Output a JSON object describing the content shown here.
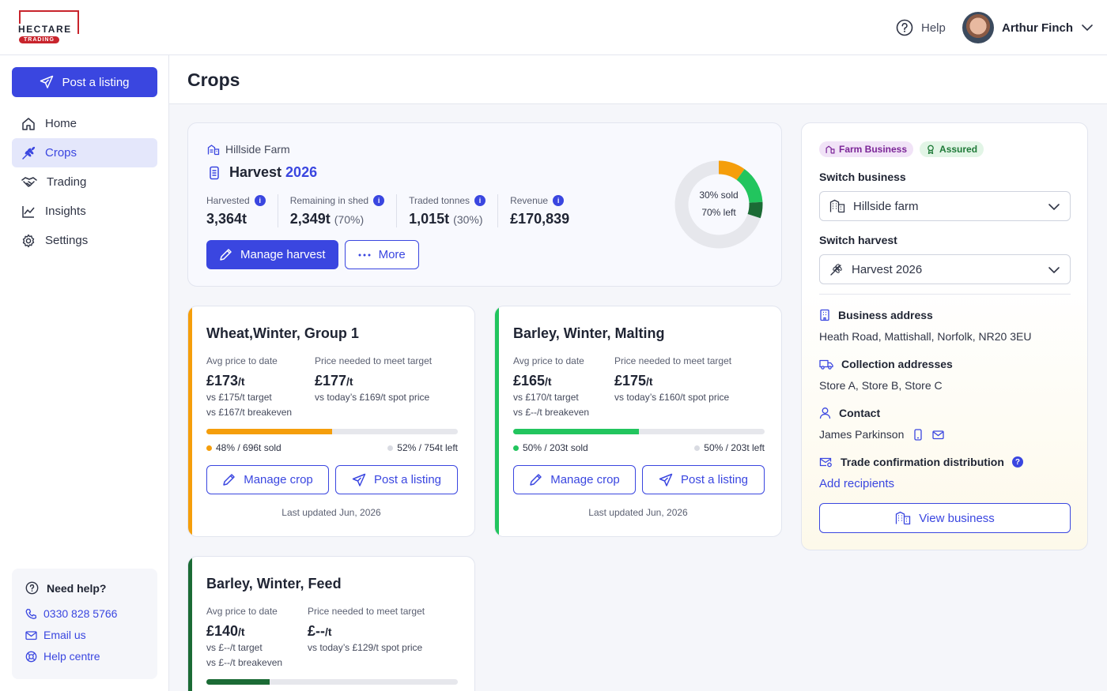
{
  "brand": {
    "name": "HECTARE",
    "sub": "TRADING",
    "accent": "#c8242c",
    "primary": "#3a46e0"
  },
  "topbar": {
    "help_label": "Help",
    "user_name": "Arthur Finch"
  },
  "sidebar": {
    "post_label": "Post a listing",
    "items": [
      {
        "label": "Home",
        "icon": "home-icon"
      },
      {
        "label": "Crops",
        "icon": "wheat-icon",
        "active": true
      },
      {
        "label": "Trading",
        "icon": "handshake-icon"
      },
      {
        "label": "Insights",
        "icon": "chart-line-icon"
      },
      {
        "label": "Settings",
        "icon": "gear-icon"
      }
    ],
    "help": {
      "title": "Need help?",
      "phone": "0330 828 5766",
      "email": "Email us",
      "centre": "Help centre"
    }
  },
  "page": {
    "title": "Crops"
  },
  "harvest": {
    "farm": "Hillside Farm",
    "title": "Harvest",
    "year": "2026",
    "stats": [
      {
        "label": "Harvested",
        "value": "3,364t",
        "pct": ""
      },
      {
        "label": "Remaining in shed",
        "value": "2,349t",
        "pct": "(70%)"
      },
      {
        "label": "Traded tonnes",
        "value": "1,015t",
        "pct": "(30%)"
      },
      {
        "label": "Revenue",
        "value": "£170,839",
        "pct": ""
      }
    ],
    "manage_label": "Manage harvest",
    "more_label": "More",
    "donut": {
      "sold_text": "30% sold",
      "left_text": "70% left",
      "segments": [
        0.1,
        0.14,
        0.06
      ],
      "colors": [
        "#f59e0b",
        "#22c55e",
        "#1b6b35"
      ],
      "track": "#e6e7ec"
    }
  },
  "crops": [
    {
      "name": "Wheat,Winter, Group 1",
      "color": "#f59e0b",
      "avg_label": "Avg price to date",
      "avg_price": "£173",
      "avg_unit": "/t",
      "avg_sub1": "vs £175/t target",
      "avg_sub2": "vs £167/t breakeven",
      "need_label": "Price needed to meet target",
      "need_price": "£177",
      "need_unit": "/t",
      "need_sub": "vs today’s £169/t spot price",
      "sold_fraction": 0.5,
      "sold_text": "48% / 696t sold",
      "left_text": "52% / 754t left",
      "manage_label": "Manage crop",
      "post_label": "Post a listing",
      "updated": "Last updated Jun, 2026"
    },
    {
      "name": "Barley, Winter, Malting",
      "color": "#22c55e",
      "avg_label": "Avg price to date",
      "avg_price": "£165",
      "avg_unit": "/t",
      "avg_sub1": "vs £170/t target",
      "avg_sub2": "vs £--/t breakeven",
      "need_label": "Price needed to meet target",
      "need_price": "£175",
      "need_unit": "/t",
      "need_sub": "vs today’s £160/t spot price",
      "sold_fraction": 0.5,
      "sold_text": "50% / 203t sold",
      "left_text": "50% / 203t left",
      "manage_label": "Manage crop",
      "post_label": "Post a listing",
      "updated": "Last updated Jun, 2026"
    },
    {
      "name": "Barley, Winter, Feed",
      "color": "#1b6b35",
      "avg_label": "Avg price to date",
      "avg_price": "£140",
      "avg_unit": "/t",
      "avg_sub1": "vs £--/t target",
      "avg_sub2": "vs £--/t breakeven",
      "need_label": "Price needed to meet target",
      "need_price": "£--",
      "need_unit": "/t",
      "need_sub": "vs today’s £129/t spot price",
      "sold_fraction": 0.25
    }
  ],
  "business": {
    "tag1": "Farm Business",
    "tag2": "Assured",
    "switch_business_label": "Switch business",
    "business_value": "Hillside farm",
    "switch_harvest_label": "Switch harvest",
    "harvest_value": "Harvest 2026",
    "address_label": "Business address",
    "address": "Heath Road, Mattishall, Norfolk, NR20 3EU",
    "collection_label": "Collection addresses",
    "collection": "Store A, Store B, Store C",
    "contact_label": "Contact",
    "contact": "James Parkinson",
    "trade_label": "Trade confirmation distribution",
    "add_recipients": "Add recipients",
    "view_label": "View business"
  }
}
